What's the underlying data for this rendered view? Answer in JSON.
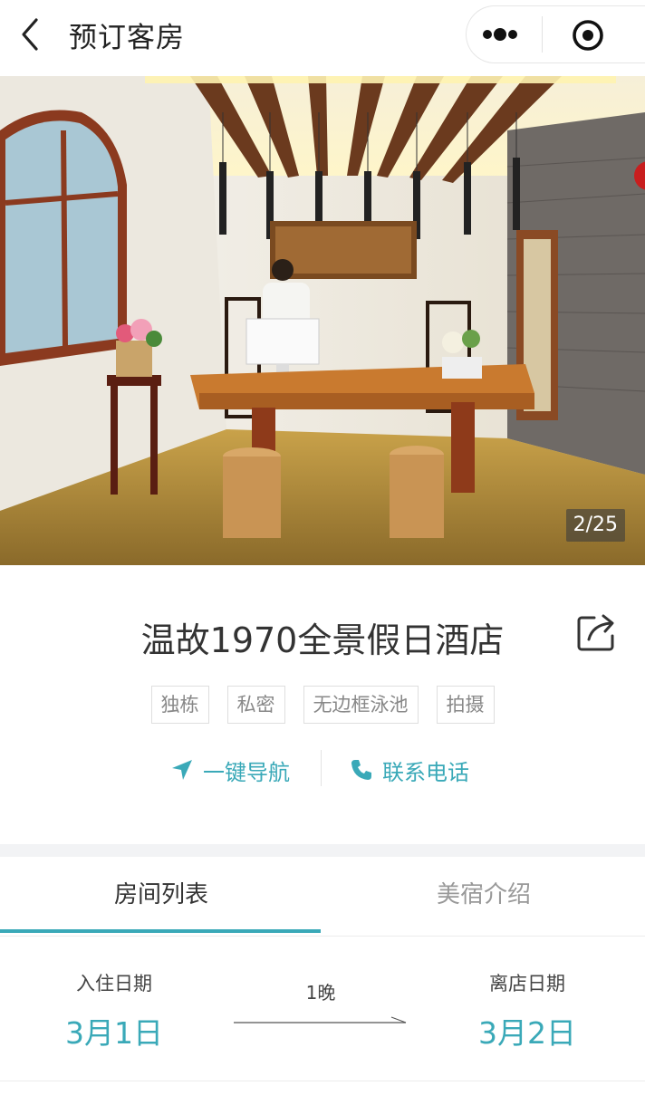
{
  "nav": {
    "title": "预订客房",
    "back_icon": "back-arrow-icon",
    "more_icon": "more-dots-icon",
    "close_icon": "target-icon"
  },
  "hero": {
    "counter": "2/25"
  },
  "hotel": {
    "name": "温故1970全景假日酒店",
    "share_icon": "share-icon",
    "tags": [
      "独栋",
      "私密",
      "无边框泳池",
      "拍摄"
    ],
    "navigate_label": "一键导航",
    "call_label": "联系电话"
  },
  "tabs": [
    {
      "label": "房间列表",
      "active": true
    },
    {
      "label": "美宿介绍",
      "active": false
    }
  ],
  "dates": {
    "checkin_label": "入住日期",
    "checkin_value": "3月1日",
    "nights": "1晚",
    "checkout_label": "离店日期",
    "checkout_value": "3月2日"
  },
  "colors": {
    "accent": "#3aa9b8",
    "text": "#333333",
    "muted": "#999999"
  }
}
